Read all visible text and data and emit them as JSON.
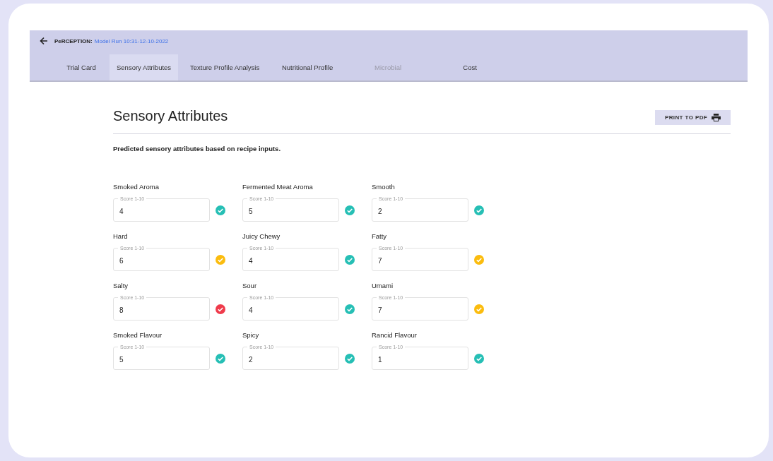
{
  "header": {
    "app_name": "PeRCEPTION:",
    "run_name": "Model Run 10:31-12-10-2022"
  },
  "tabs": [
    {
      "label": "Trial Card",
      "selected": false,
      "disabled": false
    },
    {
      "label": "Sensory Attributes",
      "selected": true,
      "disabled": false
    },
    {
      "label": "Texture Profile Analysis",
      "selected": false,
      "disabled": false
    },
    {
      "label": "Nutritional Profile",
      "selected": false,
      "disabled": false
    },
    {
      "label": "Microbial",
      "selected": false,
      "disabled": true
    },
    {
      "label": "Cost",
      "selected": false,
      "disabled": false
    }
  ],
  "page": {
    "title": "Sensory Attributes",
    "print_button": "PRINT TO PDF",
    "description": "Predicted sensory attributes based on recipe inputs."
  },
  "attributes": [
    {
      "name": "Smoked Aroma",
      "field_label": "Score 1-10",
      "value": "4",
      "color": "#26bfb5"
    },
    {
      "name": "Fermented Meat Aroma",
      "field_label": "Score 1-10",
      "value": "5",
      "color": "#26bfb5"
    },
    {
      "name": "Smooth",
      "field_label": "Score 1-10",
      "value": "2",
      "color": "#26bfb5"
    },
    {
      "name": "Hard",
      "field_label": "Score 1-10",
      "value": "6",
      "color": "#fbbc0e"
    },
    {
      "name": "Juicy Chewy",
      "field_label": "Score 1-10",
      "value": "4",
      "color": "#26bfb5"
    },
    {
      "name": "Fatty",
      "field_label": "Score 1-10",
      "value": "7",
      "color": "#fbbc0e"
    },
    {
      "name": "Salty",
      "field_label": "Score 1-10",
      "value": "8",
      "color": "#ef3b4b"
    },
    {
      "name": "Sour",
      "field_label": "Score 1-10",
      "value": "4",
      "color": "#26bfb5"
    },
    {
      "name": "Umami",
      "field_label": "Score 1-10",
      "value": "7",
      "color": "#fbbc0e"
    },
    {
      "name": "Smoked Flavour",
      "field_label": "Score 1-10",
      "value": "5",
      "color": "#26bfb5"
    },
    {
      "name": "Spicy",
      "field_label": "Score 1-10",
      "value": "2",
      "color": "#26bfb5"
    },
    {
      "name": "Rancid Flavour",
      "field_label": "Score 1-10",
      "value": "1",
      "color": "#26bfb5"
    }
  ]
}
